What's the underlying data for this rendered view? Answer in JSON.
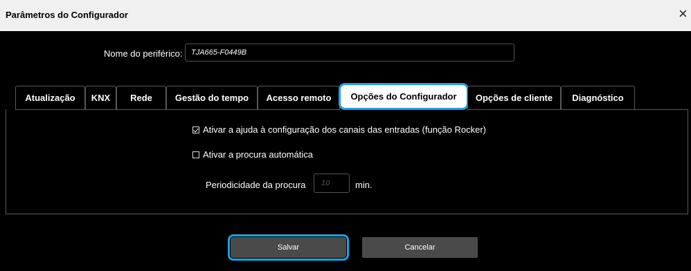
{
  "window": {
    "title": "Parâmetros do Configurador",
    "close_glyph": "×"
  },
  "device": {
    "label": "Nome do periférico:",
    "value": "TJA665-F0449B"
  },
  "tabs": [
    {
      "label": "Atualização",
      "active": false
    },
    {
      "label": "KNX",
      "active": false
    },
    {
      "label": "Rede",
      "active": false
    },
    {
      "label": "Gestão do tempo",
      "active": false
    },
    {
      "label": "Acesso remoto",
      "active": false
    },
    {
      "label": "Opções do Configurador",
      "active": true
    },
    {
      "label": "Opções de cliente",
      "active": false
    },
    {
      "label": "Diagnóstico",
      "active": false
    }
  ],
  "options": {
    "rocker_help": {
      "label": "Ativar a ajuda à configuração dos canais das entradas (função Rocker)",
      "checked": true
    },
    "auto_search": {
      "label": "Ativar a procura automática",
      "checked": false
    },
    "period_label": "Periodicidade da procura",
    "period_placeholder": "10",
    "period_unit": "min."
  },
  "buttons": {
    "save": "Salvar",
    "cancel": "Cancelar"
  },
  "colors": {
    "accent": "#1da1e3",
    "background": "#000000",
    "titlebar": "#f0f0f0",
    "button": "#4a4a4a"
  }
}
